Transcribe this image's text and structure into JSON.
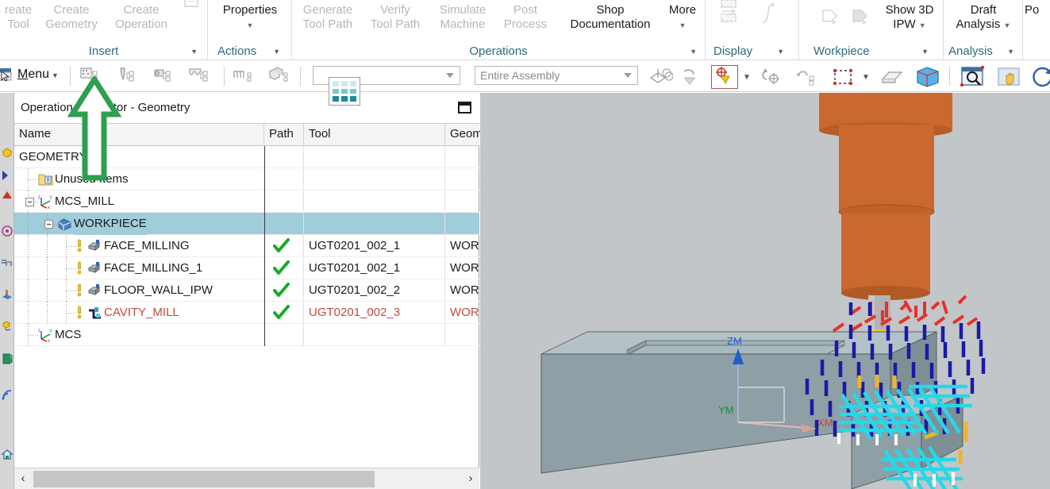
{
  "ribbon": {
    "groups": [
      {
        "name": "Insert",
        "title": "Insert",
        "buttons": [
          {
            "l1": "reate",
            "l2": "Tool",
            "enabled": false
          },
          {
            "l1": "Create",
            "l2": "Geometry",
            "enabled": false
          },
          {
            "l1": "Create",
            "l2": "Operation",
            "enabled": false
          }
        ]
      },
      {
        "name": "Actions",
        "title": "Actions",
        "buttons": [
          {
            "l1": "Properties",
            "l2": "",
            "enabled": true,
            "caret": true
          }
        ]
      },
      {
        "name": "Operations",
        "title": "Operations",
        "buttons": [
          {
            "l1": "Generate",
            "l2": "Tool Path",
            "enabled": false
          },
          {
            "l1": "Verify",
            "l2": "Tool Path",
            "enabled": false
          },
          {
            "l1": "Simulate",
            "l2": "Machine",
            "enabled": false
          },
          {
            "l1": "Post",
            "l2": "Process",
            "enabled": false
          },
          {
            "l1": "Shop",
            "l2": "Documentation",
            "enabled": true
          },
          {
            "l1": "More",
            "l2": "",
            "enabled": true,
            "caret": true
          }
        ]
      },
      {
        "name": "Display",
        "title": "Display",
        "buttons": []
      },
      {
        "name": "Workpiece",
        "title": "Workpiece",
        "buttons": [
          {
            "l1": "Show 3D",
            "l2": "IPW",
            "enabled": true,
            "inlinecaret": true
          }
        ]
      },
      {
        "name": "Analysis",
        "title": "Analysis",
        "buttons": [
          {
            "l1": "Draft",
            "l2": "Analysis",
            "enabled": true,
            "inlinecaret": true
          }
        ]
      },
      {
        "name": "Post-cut",
        "title": "",
        "buttons": [
          {
            "l1": "Po",
            "l2": "",
            "enabled": true
          }
        ]
      }
    ]
  },
  "toolbar": {
    "menu_label": "Menu",
    "menu_mnemonic": "M",
    "menu_rest": "enu",
    "filter_combo_value": "",
    "assembly_combo_value": "Entire Assembly",
    "icons": [
      "create-geometry-icon",
      "create-tool-icon",
      "create-operation-icon",
      "machining-feature-icon",
      "program-order-icon",
      "group-objects-icon",
      "wcs-dynamic-icon",
      "undo-icon",
      "snap-icon",
      "rectangle-select-icon",
      "hide-icon",
      "section-box-icon",
      "zoom-window-icon",
      "pan-icon",
      "rotate-icon"
    ]
  },
  "navigator": {
    "title": "Operation Navigator - Geometry",
    "columns": [
      {
        "key": "name",
        "label": "Name"
      },
      {
        "key": "path",
        "label": "Path"
      },
      {
        "key": "tool",
        "label": "Tool"
      },
      {
        "key": "geom",
        "label": "Geom"
      }
    ],
    "rows": [
      {
        "name": "GEOMETRY",
        "indent": 0,
        "path": "",
        "tool": "",
        "geom": "",
        "icon": "none",
        "expander": false,
        "warn": false,
        "selected": false,
        "red": false
      },
      {
        "name": "Unused Items",
        "indent": 1,
        "path": "",
        "tool": "",
        "geom": "",
        "icon": "folder-icon",
        "expander": false,
        "warn": false,
        "selected": false,
        "red": false
      },
      {
        "name": "MCS_MILL",
        "indent": 1,
        "path": "",
        "tool": "",
        "geom": "",
        "icon": "mcs-icon",
        "expander": true,
        "warn": false,
        "selected": false,
        "red": false
      },
      {
        "name": "WORKPIECE",
        "indent": 2,
        "path": "",
        "tool": "",
        "geom": "",
        "icon": "workpiece-icon",
        "expander": true,
        "warn": false,
        "selected": true,
        "red": false
      },
      {
        "name": "FACE_MILLING",
        "indent": 3,
        "path": "ok",
        "tool": "UGT0201_002_1",
        "geom": "WOR",
        "icon": "facemill-icon",
        "expander": false,
        "warn": true,
        "selected": false,
        "red": false
      },
      {
        "name": "FACE_MILLING_1",
        "indent": 3,
        "path": "ok",
        "tool": "UGT0201_002_1",
        "geom": "WOR",
        "icon": "facemill-icon",
        "expander": false,
        "warn": true,
        "selected": false,
        "red": false
      },
      {
        "name": "FLOOR_WALL_IPW",
        "indent": 3,
        "path": "ok",
        "tool": "UGT0201_002_2",
        "geom": "WOR",
        "icon": "facemill-icon",
        "expander": false,
        "warn": true,
        "selected": false,
        "red": false
      },
      {
        "name": "CAVITY_MILL",
        "indent": 3,
        "path": "ok",
        "tool": "UGT0201_002_3",
        "geom": "WOR",
        "icon": "cavitymill-icon",
        "expander": false,
        "warn": true,
        "selected": false,
        "red": true
      },
      {
        "name": "MCS",
        "indent": 1,
        "path": "",
        "tool": "",
        "geom": "",
        "icon": "mcs-icon",
        "expander": false,
        "warn": false,
        "selected": false,
        "red": false
      }
    ],
    "scroll_left_label": "‹",
    "scroll_right_label": "›"
  },
  "viewport": {
    "axis_labels": {
      "zm": "ZM",
      "ym": "YM",
      "xm": "XM"
    },
    "colors": {
      "background": "#c3c6c8",
      "holder": "#c9682f",
      "shank": "#b3b3b3",
      "cutter": "#f2c518",
      "stock_top": "#b4c1c6",
      "stock_front": "#8e9fa5",
      "stock_side": "#9aaab0",
      "rapid_move": "#e8302a",
      "engage_move": "#1a1aa8",
      "cut_move": "#26d8e8",
      "axis_z": "#1e5fd0",
      "axis_y": "#1c8c35",
      "axis_x": "#d03a33"
    }
  },
  "annotation": {
    "arrow_color": "#2e9e4f",
    "points_to": "create-geometry-toolbar-icon"
  },
  "theme": {
    "ribbon_group_title": "#2a6b7c",
    "selection_blue": "#9fcddb",
    "red_text": "#c14a3f",
    "check_green": "#14aa28"
  }
}
